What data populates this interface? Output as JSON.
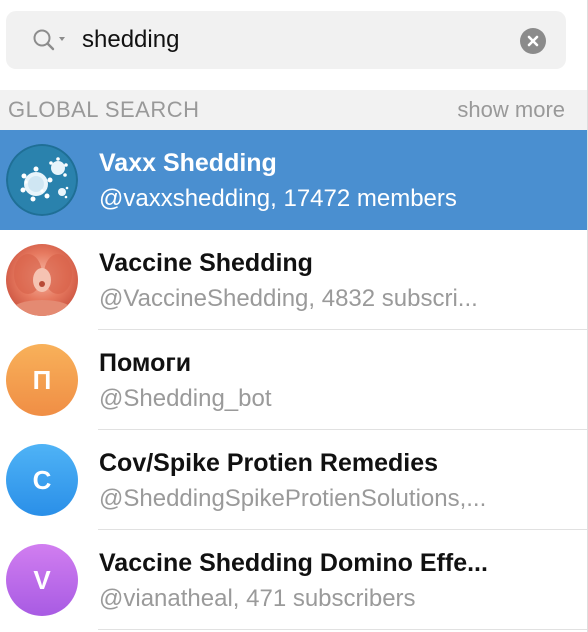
{
  "search": {
    "value": "shedding",
    "icon": "search-icon"
  },
  "section": {
    "title": "GLOBAL SEARCH",
    "show_more": "show more"
  },
  "results": [
    {
      "title": "Vaxx Shedding",
      "subtitle": "@vaxxshedding, 17472 members",
      "avatar": "virus-image",
      "active": true
    },
    {
      "title": "Vaccine Shedding",
      "subtitle": "@VaccineShedding, 4832 subscri...",
      "avatar": "photo",
      "active": false
    },
    {
      "title": "Помоги",
      "subtitle": "@Shedding_bot",
      "avatar_letter": "П",
      "avatar_color": "#f5a04f",
      "active": false
    },
    {
      "title": "Cov/Spike Protien Remedies",
      "subtitle": "@SheddingSpikeProtienSolutions,...",
      "avatar_letter": "C",
      "avatar_color": "#3b9df0",
      "active": false
    },
    {
      "title": "Vaccine Shedding Domino Effe...",
      "subtitle": "@vianatheal, 471 subscribers",
      "avatar_letter": "V",
      "avatar_color": "#b66ae8",
      "active": false
    }
  ],
  "colors": {
    "active_row": "#4a8fd0",
    "secondary_text": "#9a9a9a"
  }
}
